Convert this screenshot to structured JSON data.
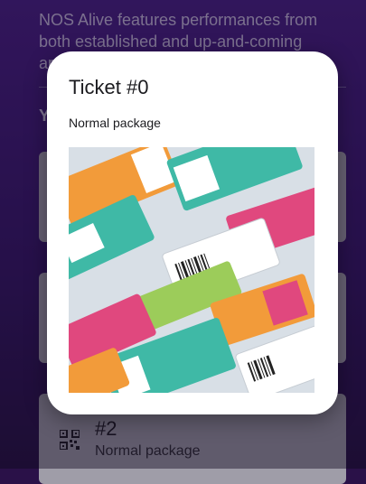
{
  "background": {
    "description_line1": "NOS Alive features performances from",
    "description_line2": "both established and up-and-coming",
    "description_line3": "ar",
    "section_partial": "Y"
  },
  "ticket_card": {
    "number": "#2",
    "package": "Normal package",
    "icon": "qr-code-icon"
  },
  "modal": {
    "title": "Ticket #0",
    "subtitle": "Normal package",
    "image": "ticket-illustration"
  },
  "colors": {
    "background_purple": "#4a1f8a",
    "modal_bg": "#ffffff",
    "teal": "#3fb9a6",
    "orange": "#f29b3a",
    "pink": "#e0487e"
  }
}
